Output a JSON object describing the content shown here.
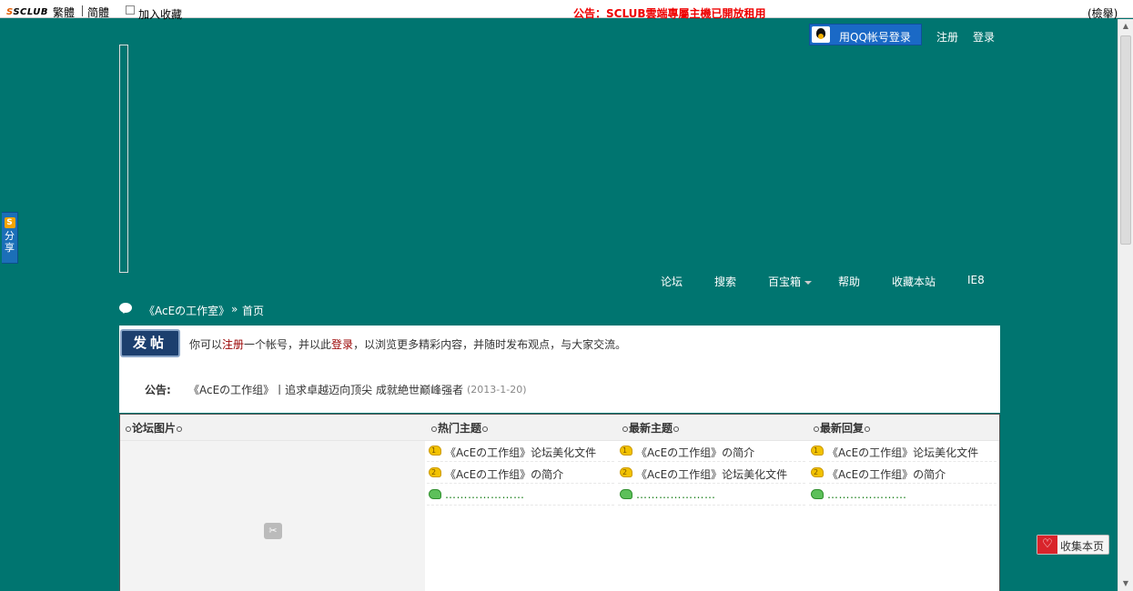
{
  "topbar": {
    "logo": "SCLUB",
    "traditional": "繁體",
    "simplified": "简體",
    "add_favorite": "加入收藏",
    "notice": "公告：SCLUB雲端專屬主機已開放租用",
    "report": "(檢舉)"
  },
  "share_tab": {
    "icon_letter": "S",
    "label_1": "分",
    "label_2": "享"
  },
  "header": {
    "qq_login": "用QQ帐号登录",
    "register": "注册",
    "login": "登录"
  },
  "nav": {
    "items": [
      "论坛",
      "搜索",
      "百宝箱",
      "帮助",
      "收藏本站",
      "IE8"
    ]
  },
  "breadcrumb": {
    "site": "《AcEの工作室》",
    "arrow": "»",
    "home": "首页"
  },
  "notice_panel": {
    "post_button": "发帖",
    "welcome_prefix": "你可以",
    "register_link": "注册",
    "welcome_mid": "一个帐号，并以此",
    "login_link": "登录",
    "welcome_suffix": "，以浏览更多精彩内容，并随时发布观点，与大家交流。",
    "announcement_label": "公告:",
    "announcement_text": "《AcEの工作组》丨追求卓越迈向顶尖 成就絶世巅峰强者",
    "announcement_date": "(2013-1-20)"
  },
  "forum": {
    "pictures_title": "论坛图片",
    "hot_title": "热门主题",
    "new_title": "最新主题",
    "reply_title": "最新回复",
    "hot_items": [
      "《AcEの工作组》论坛美化文件",
      "《AcEの工作组》の简介",
      "…………………"
    ],
    "new_items": [
      "《AcEの工作组》の简介",
      "《AcEの工作组》论坛美化文件",
      "…………………"
    ],
    "reply_items": [
      "《AcEの工作组》论坛美化文件",
      "《AcEの工作组》の简介",
      "…………………"
    ],
    "hot_numbers": [
      "1",
      "2"
    ],
    "new_numbers": [
      "1",
      "2"
    ],
    "reply_numbers": [
      "1",
      "2"
    ]
  },
  "bookmark": {
    "label": "收集本页"
  },
  "colors": {
    "background": "#007570",
    "notice_red": "#e00000",
    "link_red": "#990000",
    "qq_blue": "#1a69c6"
  }
}
